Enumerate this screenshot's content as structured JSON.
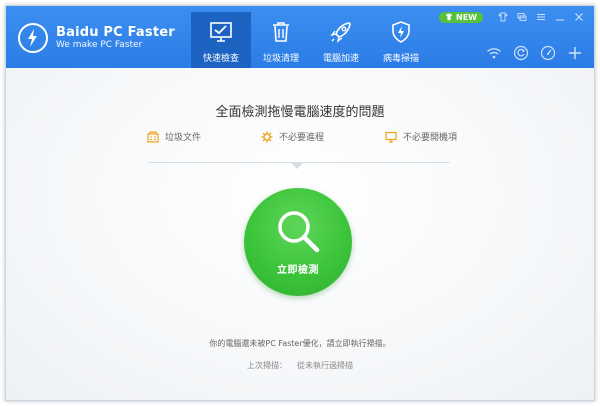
{
  "app": {
    "title": "Baidu PC Faster",
    "subtitle": "We make PC Faster"
  },
  "nav": {
    "items": [
      {
        "label": "快速檢查",
        "icon": "monitor-check-icon",
        "active": true
      },
      {
        "label": "垃圾清理",
        "icon": "trash-icon",
        "active": false
      },
      {
        "label": "電腦加速",
        "icon": "rocket-icon",
        "active": false
      },
      {
        "label": "病毒掃描",
        "icon": "shield-lightning-icon",
        "active": false
      }
    ]
  },
  "top_controls": {
    "new_badge": "NEW",
    "icons": [
      "shirt-icon",
      "chat-icon",
      "menu-icon",
      "minimize-icon",
      "close-icon"
    ]
  },
  "tools": [
    "wifi-icon",
    "refresh-icon",
    "speedometer-icon",
    "plus-icon"
  ],
  "main": {
    "title": "全面檢測拖慢電腦速度的問題",
    "categories": [
      {
        "label": "垃圾文件",
        "icon": "building-icon"
      },
      {
        "label": "不必要進程",
        "icon": "gear-icon"
      },
      {
        "label": "不必要開機項",
        "icon": "monitor-icon"
      }
    ],
    "scan_button_label": "立即檢測",
    "status_text": "你的電腦還未被PC Faster優化，請立即執行掃描。",
    "last_scan_label": "上次掃描：",
    "last_scan_value": "從未執行過掃描"
  },
  "colors": {
    "header_blue": "#2b7ce6",
    "active_tab": "#1d63c2",
    "scan_green": "#3cc43b",
    "category_orange": "#f0a21e",
    "new_badge_green": "#57c13b"
  }
}
